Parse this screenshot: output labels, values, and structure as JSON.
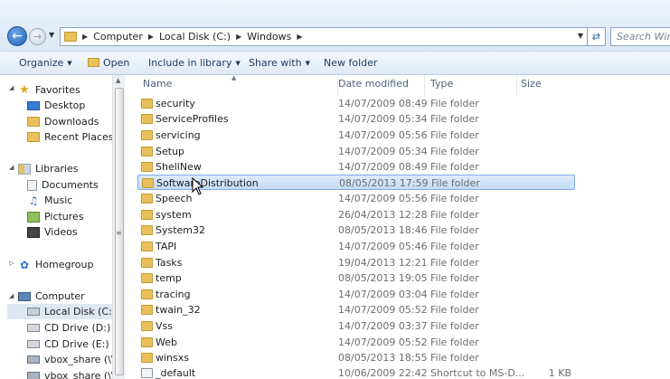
{
  "address": {
    "crumbs": [
      "Computer",
      "Local Disk (C:)",
      "Windows"
    ],
    "search_placeholder": "Search Windows"
  },
  "toolbar": {
    "organize": "Organize",
    "open": "Open",
    "include_in_library": "Include in library",
    "share_with": "Share with",
    "new_folder": "New folder"
  },
  "nav": {
    "favorites": "Favorites",
    "desktop": "Desktop",
    "downloads": "Downloads",
    "recent_places": "Recent Places",
    "libraries": "Libraries",
    "documents": "Documents",
    "music": "Music",
    "pictures": "Pictures",
    "videos": "Videos",
    "homegroup": "Homegroup",
    "computer": "Computer",
    "local_disk": "Local Disk (C:)",
    "cd_drive_d": "CD Drive (D:)",
    "cd_drive_e": "CD Drive (E:) Win",
    "vbox_share_1": "vbox_share (\\\\vb",
    "vbox_share_2": "vbox_share (\\\\VB"
  },
  "columns": {
    "name": "Name",
    "date_modified": "Date modified",
    "type": "Type",
    "size": "Size"
  },
  "files": [
    {
      "name": "security",
      "date": "14/07/2009 08:49",
      "type": "File folder",
      "size": ""
    },
    {
      "name": "ServiceProfiles",
      "date": "14/07/2009 05:34",
      "type": "File folder",
      "size": ""
    },
    {
      "name": "servicing",
      "date": "14/07/2009 05:56",
      "type": "File folder",
      "size": ""
    },
    {
      "name": "Setup",
      "date": "14/07/2009 05:34",
      "type": "File folder",
      "size": ""
    },
    {
      "name": "ShellNew",
      "date": "14/07/2009 08:49",
      "type": "File folder",
      "size": ""
    },
    {
      "name": "SoftwareDistribution",
      "date": "08/05/2013 17:59",
      "type": "File folder",
      "size": ""
    },
    {
      "name": "Speech",
      "date": "14/07/2009 05:56",
      "type": "File folder",
      "size": ""
    },
    {
      "name": "system",
      "date": "26/04/2013 12:28",
      "type": "File folder",
      "size": ""
    },
    {
      "name": "System32",
      "date": "08/05/2013 18:46",
      "type": "File folder",
      "size": ""
    },
    {
      "name": "TAPI",
      "date": "14/07/2009 05:46",
      "type": "File folder",
      "size": ""
    },
    {
      "name": "Tasks",
      "date": "19/04/2013 12:21",
      "type": "File folder",
      "size": ""
    },
    {
      "name": "temp",
      "date": "08/05/2013 19:05",
      "type": "File folder",
      "size": ""
    },
    {
      "name": "tracing",
      "date": "14/07/2009 03:04",
      "type": "File folder",
      "size": ""
    },
    {
      "name": "twain_32",
      "date": "14/07/2009 05:52",
      "type": "File folder",
      "size": ""
    },
    {
      "name": "Vss",
      "date": "14/07/2009 03:37",
      "type": "File folder",
      "size": ""
    },
    {
      "name": "Web",
      "date": "14/07/2009 05:52",
      "type": "File folder",
      "size": ""
    },
    {
      "name": "winsxs",
      "date": "08/05/2013 18:55",
      "type": "File folder",
      "size": ""
    },
    {
      "name": "_default",
      "date": "10/06/2009 22:42",
      "type": "Shortcut to MS-D...",
      "size": "1 KB"
    }
  ]
}
